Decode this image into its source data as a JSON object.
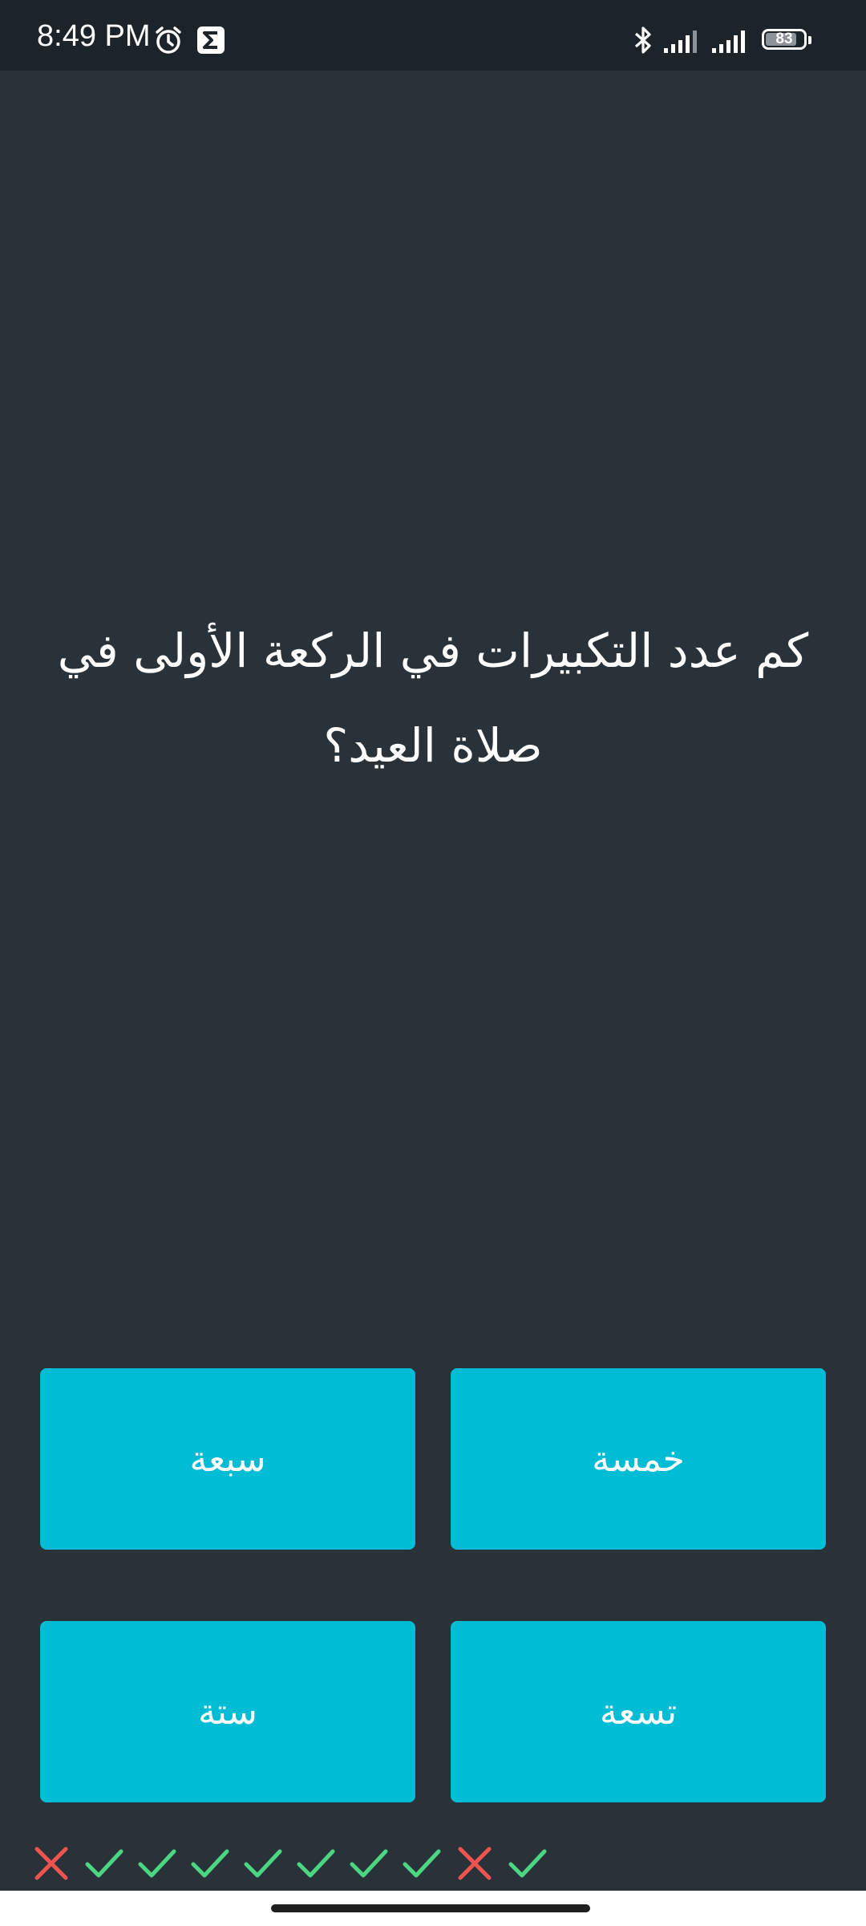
{
  "status_bar": {
    "time": "8:49 PM",
    "battery_level": "83",
    "icons": [
      "alarm-icon",
      "sigma-app-icon",
      "bluetooth-icon",
      "signal-icon",
      "signal-icon",
      "battery-icon"
    ]
  },
  "quiz": {
    "question": "كم عدد التكبيرات في الركعة الأولى في صلاة العيد؟",
    "answers": {
      "top_left": "سبعة",
      "top_right": "خمسة",
      "bottom_left": "ستة",
      "bottom_right": "تسعة"
    },
    "results": [
      "wrong",
      "correct",
      "correct",
      "correct",
      "correct",
      "correct",
      "correct",
      "correct",
      "wrong",
      "correct"
    ]
  },
  "colors": {
    "background": "#283238",
    "status_bar": "#1c2329",
    "answer_button": "#00bcd4",
    "correct": "#4cd681",
    "wrong": "#ef5350"
  }
}
